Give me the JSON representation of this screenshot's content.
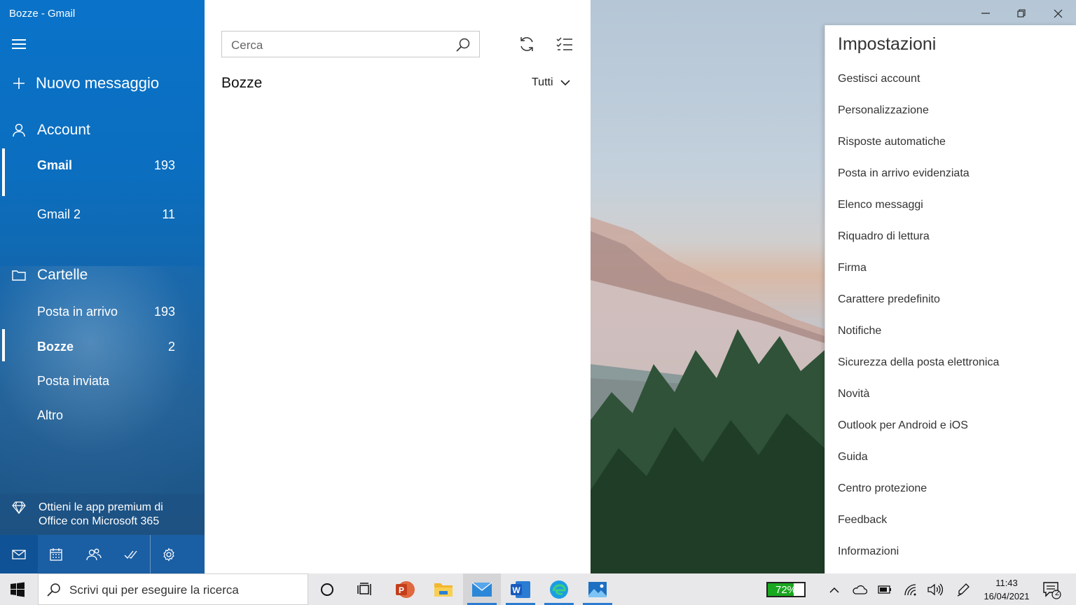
{
  "window": {
    "title": "Bozze - Gmail"
  },
  "nav": {
    "new_message": "Nuovo messaggio",
    "account_header": "Account",
    "accounts": [
      {
        "name": "Gmail",
        "count": "193"
      },
      {
        "name": "Gmail 2",
        "count": "11"
      }
    ],
    "folders_header": "Cartelle",
    "folders": [
      {
        "name": "Posta in arrivo",
        "count": "193"
      },
      {
        "name": "Bozze",
        "count": "2"
      },
      {
        "name": "Posta inviata",
        "count": ""
      },
      {
        "name": "Altro",
        "count": ""
      }
    ],
    "premium_line1": "Ottieni le app premium di",
    "premium_line2": "Office con Microsoft 365"
  },
  "list": {
    "search_placeholder": "Cerca",
    "folder_title": "Bozze",
    "filter_label": "Tutti"
  },
  "settings": {
    "title": "Impostazioni",
    "items": [
      "Gestisci account",
      "Personalizzazione",
      "Risposte automatiche",
      "Posta in arrivo evidenziata",
      "Elenco messaggi",
      "Riquadro di lettura",
      "Firma",
      "Carattere predefinito",
      "Notifiche",
      "Sicurezza della posta elettronica",
      "Novità",
      "Outlook per Android e iOS",
      "Guida",
      "Centro protezione",
      "Feedback",
      "Informazioni"
    ]
  },
  "taskbar": {
    "search_placeholder": "Scrivi qui per eseguire la ricerca",
    "battery_percent": "72%",
    "battery_level": 0.72,
    "time": "11:43",
    "date": "16/04/2021",
    "notification_count": "2"
  },
  "colors": {
    "nav_blue": "#0b6ebf",
    "battery_green": "#19a71f",
    "taskbar_accent": "#2b7bd0"
  }
}
